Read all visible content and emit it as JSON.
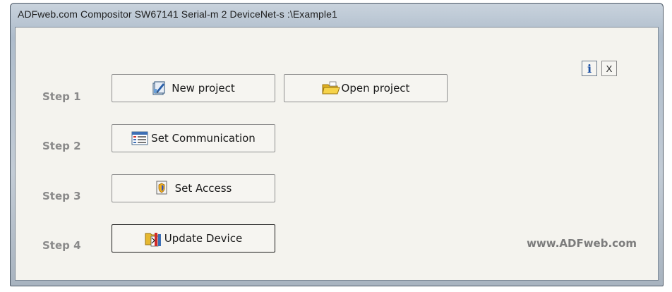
{
  "window": {
    "title": "ADFweb.com Compositor SW67141 Serial-m 2 DeviceNet-s :\\Example1"
  },
  "steps": [
    {
      "label": "Step 1"
    },
    {
      "label": "Step 2"
    },
    {
      "label": "Step 3"
    },
    {
      "label": "Step 4"
    }
  ],
  "buttons": {
    "new_project": {
      "label": "New project",
      "icon": "new-project-icon"
    },
    "open_project": {
      "label": "Open project",
      "icon": "folder-open-icon"
    },
    "set_communication": {
      "label": "Set Communication",
      "icon": "communication-table-icon"
    },
    "set_access": {
      "label": "Set Access",
      "icon": "access-icon"
    },
    "update_device": {
      "label": "Update Device",
      "icon": "update-device-icon"
    }
  },
  "corner": {
    "info_label": "i",
    "close_label": "X"
  },
  "footer": {
    "website": "www.ADFweb.com"
  }
}
